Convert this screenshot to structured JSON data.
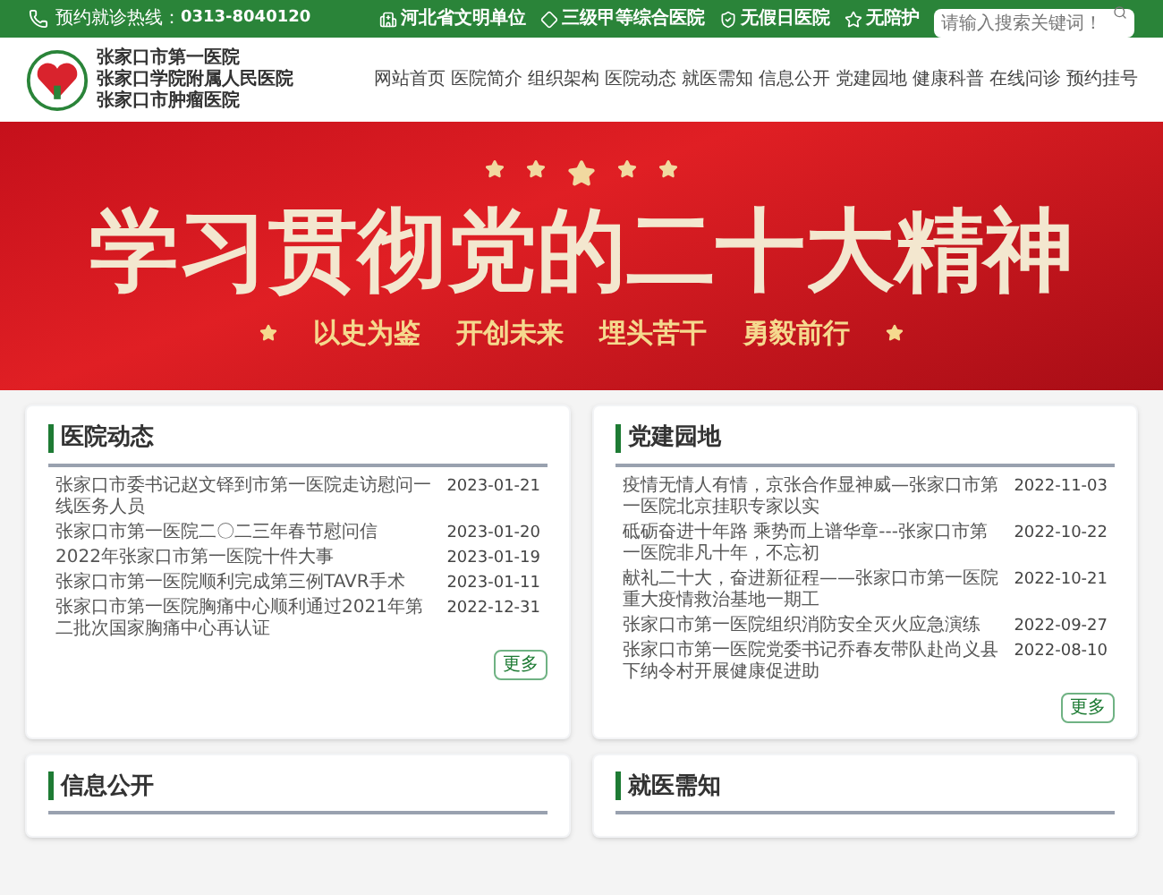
{
  "topbar": {
    "hotline_label": "预约就诊热线：",
    "hotline": "0313-8040120",
    "badges": [
      "河北省文明单位",
      "三级甲等综合医院",
      "无假日医院",
      "无陪护"
    ],
    "search": {
      "placeholder": "请输入搜索关键词！"
    }
  },
  "header": {
    "names": [
      "张家口市第一医院",
      "张家口学院附属人民医院",
      "张家口市肿瘤医院"
    ],
    "nav": [
      "网站首页",
      "医院简介",
      "组织架构",
      "医院动态",
      "就医需知",
      "信息公开",
      "党建园地",
      "健康科普",
      "在线问诊",
      "预约挂号"
    ]
  },
  "banner": {
    "headline": "学习贯彻党的二十大精神",
    "slogans": [
      "以史为鉴",
      "开创未来",
      "埋头苦干",
      "勇毅前行"
    ]
  },
  "sections": [
    {
      "title": "医院动态",
      "more": "更多",
      "items": [
        {
          "title": "张家口市委书记赵文铎到市第一医院走访慰问一线医务人员",
          "date": "2023-01-21"
        },
        {
          "title": "张家口市第一医院二〇二三年春节慰问信",
          "date": "2023-01-20"
        },
        {
          "title": "2022年张家口市第一医院十件大事",
          "date": "2023-01-19"
        },
        {
          "title": "张家口市第一医院顺利完成第三例TAVR手术",
          "date": "2023-01-11"
        },
        {
          "title": "张家口市第一医院胸痛中心顺利通过2021年第二批次国家胸痛中心再认证",
          "date": "2022-12-31"
        }
      ]
    },
    {
      "title": "党建园地",
      "more": "更多",
      "items": [
        {
          "title": "疫情无情人有情，京张合作显神威—张家口市第一医院北京挂职专家以实",
          "date": "2022-11-03"
        },
        {
          "title": "砥砺奋进十年路 乘势而上谱华章---张家口市第一医院非凡十年，不忘初",
          "date": "2022-10-22"
        },
        {
          "title": "献礼二十大，奋进新征程——张家口市第一医院重大疫情救治基地一期工",
          "date": "2022-10-21"
        },
        {
          "title": "张家口市第一医院组织消防安全灭火应急演练",
          "date": "2022-09-27"
        },
        {
          "title": "张家口市第一医院党委书记乔春友带队赴尚义县下纳令村开展健康促进助",
          "date": "2022-08-10"
        }
      ]
    },
    {
      "title": "信息公开"
    },
    {
      "title": "就医需知"
    }
  ]
}
